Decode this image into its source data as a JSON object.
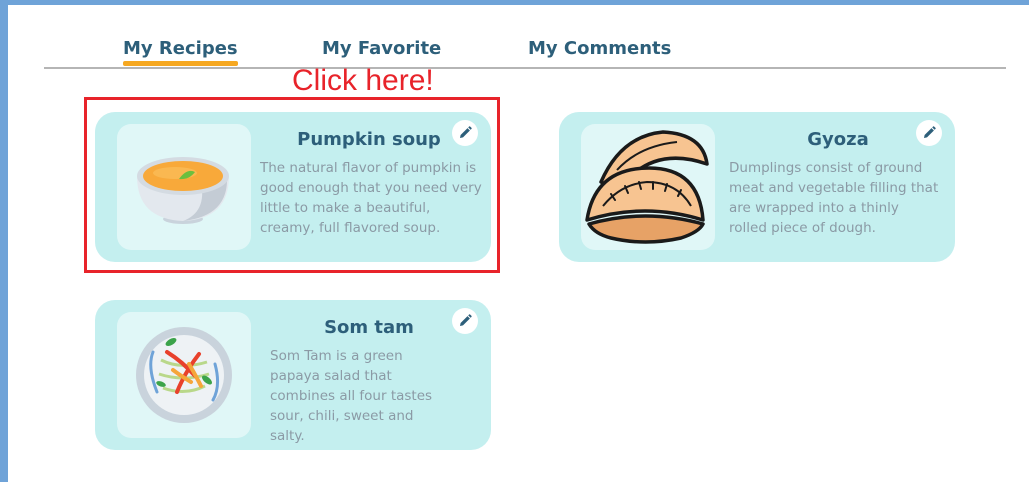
{
  "tabs": [
    {
      "label": "My Recipes",
      "active": true
    },
    {
      "label": "My Favorite",
      "active": false
    },
    {
      "label": "My Comments",
      "active": false
    }
  ],
  "annotation": {
    "hint": "Click here!"
  },
  "cards": [
    {
      "title": "Pumpkin soup",
      "description": "The natural flavor of pumpkin is good enough that you need very little to make a beautiful, creamy, full flavored soup.",
      "image_icon": "pumpkin-soup-bowl-icon"
    },
    {
      "title": "Gyoza",
      "description": "Dumplings consist of ground meat and vegetable filling that are wrapped into a thinly rolled piece of dough.",
      "image_icon": "gyoza-dumplings-icon"
    },
    {
      "title": "Som tam",
      "description": "Som Tam is a green papaya salad that combines all four tastes sour, chili, sweet and salty.",
      "image_icon": "som-tam-salad-plate-icon"
    }
  ],
  "colors": {
    "accent": "#f6a821",
    "title_text": "#2d5f7a",
    "card_bg": "#c4efef",
    "highlight": "#e8232a",
    "frame": "#6fa3d8"
  }
}
